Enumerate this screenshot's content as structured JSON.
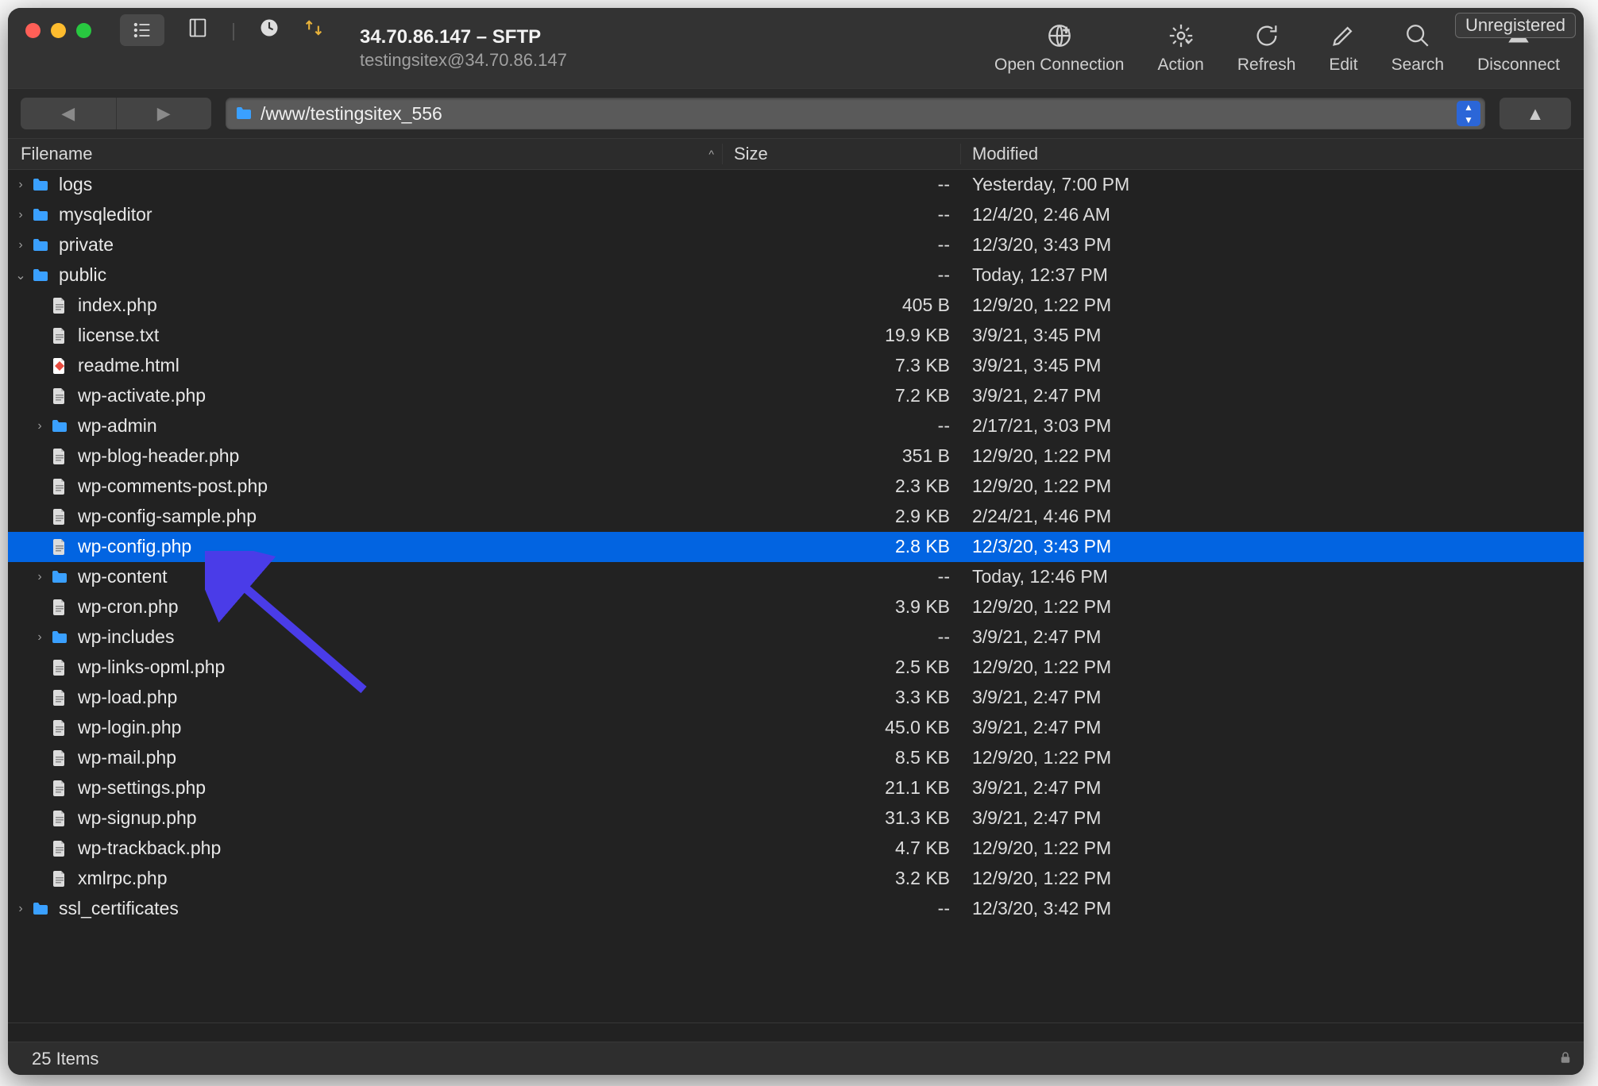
{
  "window": {
    "title_line1": "34.70.86.147 – SFTP",
    "title_line2": "testingsitex@34.70.86.147",
    "unregistered_label": "Unregistered"
  },
  "toolbar": {
    "open_connection": "Open Connection",
    "action": "Action",
    "refresh": "Refresh",
    "edit": "Edit",
    "search": "Search",
    "disconnect": "Disconnect"
  },
  "path": "/www/testingsitex_556",
  "columns": {
    "filename": "Filename",
    "size": "Size",
    "modified": "Modified",
    "sort_indicator": "^"
  },
  "rows": [
    {
      "indent": 0,
      "expand": "closed",
      "type": "folder",
      "name": "logs",
      "size": "--",
      "modified": "Yesterday, 7:00 PM",
      "selected": false
    },
    {
      "indent": 0,
      "expand": "closed",
      "type": "folder",
      "name": "mysqleditor",
      "size": "--",
      "modified": "12/4/20, 2:46 AM",
      "selected": false
    },
    {
      "indent": 0,
      "expand": "closed",
      "type": "folder",
      "name": "private",
      "size": "--",
      "modified": "12/3/20, 3:43 PM",
      "selected": false
    },
    {
      "indent": 0,
      "expand": "open",
      "type": "folder",
      "name": "public",
      "size": "--",
      "modified": "Today, 12:37 PM",
      "selected": false
    },
    {
      "indent": 1,
      "expand": "none",
      "type": "file",
      "name": "index.php",
      "size": "405 B",
      "modified": "12/9/20, 1:22 PM",
      "selected": false
    },
    {
      "indent": 1,
      "expand": "none",
      "type": "file",
      "name": "license.txt",
      "size": "19.9 KB",
      "modified": "3/9/21, 3:45 PM",
      "selected": false
    },
    {
      "indent": 1,
      "expand": "none",
      "type": "html",
      "name": "readme.html",
      "size": "7.3 KB",
      "modified": "3/9/21, 3:45 PM",
      "selected": false
    },
    {
      "indent": 1,
      "expand": "none",
      "type": "file",
      "name": "wp-activate.php",
      "size": "7.2 KB",
      "modified": "3/9/21, 2:47 PM",
      "selected": false
    },
    {
      "indent": 1,
      "expand": "closed",
      "type": "folder",
      "name": "wp-admin",
      "size": "--",
      "modified": "2/17/21, 3:03 PM",
      "selected": false
    },
    {
      "indent": 1,
      "expand": "none",
      "type": "file",
      "name": "wp-blog-header.php",
      "size": "351 B",
      "modified": "12/9/20, 1:22 PM",
      "selected": false
    },
    {
      "indent": 1,
      "expand": "none",
      "type": "file",
      "name": "wp-comments-post.php",
      "size": "2.3 KB",
      "modified": "12/9/20, 1:22 PM",
      "selected": false
    },
    {
      "indent": 1,
      "expand": "none",
      "type": "file",
      "name": "wp-config-sample.php",
      "size": "2.9 KB",
      "modified": "2/24/21, 4:46 PM",
      "selected": false
    },
    {
      "indent": 1,
      "expand": "none",
      "type": "file",
      "name": "wp-config.php",
      "size": "2.8 KB",
      "modified": "12/3/20, 3:43 PM",
      "selected": true
    },
    {
      "indent": 1,
      "expand": "closed",
      "type": "folder",
      "name": "wp-content",
      "size": "--",
      "modified": "Today, 12:46 PM",
      "selected": false
    },
    {
      "indent": 1,
      "expand": "none",
      "type": "file",
      "name": "wp-cron.php",
      "size": "3.9 KB",
      "modified": "12/9/20, 1:22 PM",
      "selected": false
    },
    {
      "indent": 1,
      "expand": "closed",
      "type": "folder",
      "name": "wp-includes",
      "size": "--",
      "modified": "3/9/21, 2:47 PM",
      "selected": false
    },
    {
      "indent": 1,
      "expand": "none",
      "type": "file",
      "name": "wp-links-opml.php",
      "size": "2.5 KB",
      "modified": "12/9/20, 1:22 PM",
      "selected": false
    },
    {
      "indent": 1,
      "expand": "none",
      "type": "file",
      "name": "wp-load.php",
      "size": "3.3 KB",
      "modified": "3/9/21, 2:47 PM",
      "selected": false
    },
    {
      "indent": 1,
      "expand": "none",
      "type": "file",
      "name": "wp-login.php",
      "size": "45.0 KB",
      "modified": "3/9/21, 2:47 PM",
      "selected": false
    },
    {
      "indent": 1,
      "expand": "none",
      "type": "file",
      "name": "wp-mail.php",
      "size": "8.5 KB",
      "modified": "12/9/20, 1:22 PM",
      "selected": false
    },
    {
      "indent": 1,
      "expand": "none",
      "type": "file",
      "name": "wp-settings.php",
      "size": "21.1 KB",
      "modified": "3/9/21, 2:47 PM",
      "selected": false
    },
    {
      "indent": 1,
      "expand": "none",
      "type": "file",
      "name": "wp-signup.php",
      "size": "31.3 KB",
      "modified": "3/9/21, 2:47 PM",
      "selected": false
    },
    {
      "indent": 1,
      "expand": "none",
      "type": "file",
      "name": "wp-trackback.php",
      "size": "4.7 KB",
      "modified": "12/9/20, 1:22 PM",
      "selected": false
    },
    {
      "indent": 1,
      "expand": "none",
      "type": "file",
      "name": "xmlrpc.php",
      "size": "3.2 KB",
      "modified": "12/9/20, 1:22 PM",
      "selected": false
    },
    {
      "indent": 0,
      "expand": "closed",
      "type": "folder",
      "name": "ssl_certificates",
      "size": "--",
      "modified": "12/3/20, 3:42 PM",
      "selected": false
    }
  ],
  "status": {
    "item_count_label": "25 Items"
  }
}
